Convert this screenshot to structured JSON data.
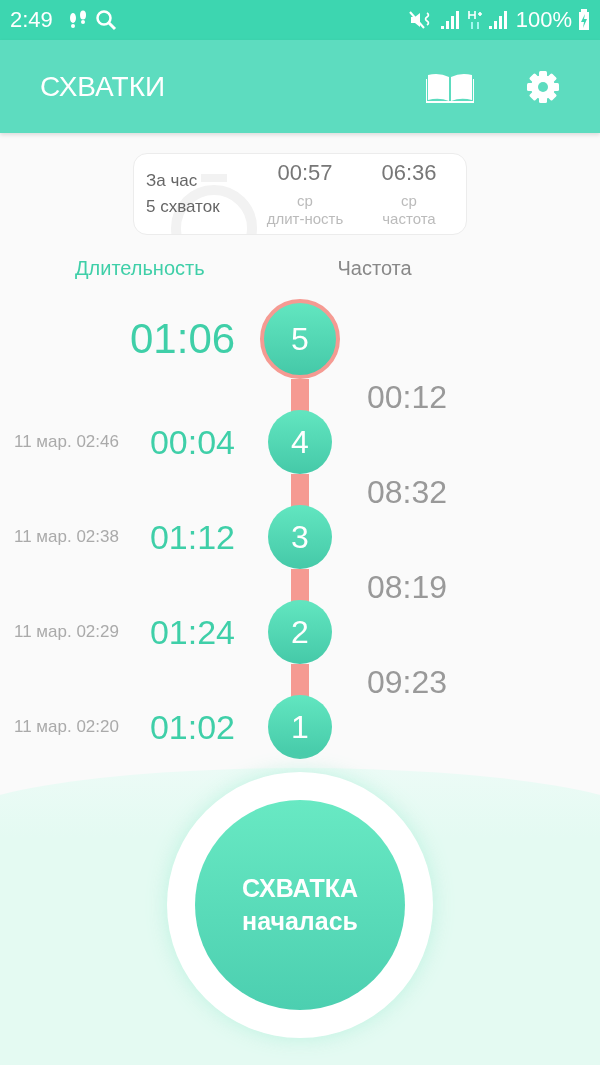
{
  "status_bar": {
    "time": "2:49",
    "battery": "100%"
  },
  "app_bar": {
    "title": "СХВАТКИ"
  },
  "summary": {
    "period": "За час",
    "count": "5 схваток",
    "stats": [
      {
        "value": "00:57",
        "prefix": "ср",
        "label": "длит-ность"
      },
      {
        "value": "06:36",
        "prefix": "ср",
        "label": "частота"
      }
    ]
  },
  "columns": [
    {
      "label": "Длительность",
      "selected": true
    },
    {
      "label": "Частота",
      "selected": false
    }
  ],
  "contractions": [
    {
      "number": "5",
      "duration": "01:06",
      "current": true,
      "interval_after": "00:12"
    },
    {
      "number": "4",
      "date": "11 мар. 02:46",
      "duration": "00:04",
      "current": false,
      "interval_after": "08:32"
    },
    {
      "number": "3",
      "date": "11 мар. 02:38",
      "duration": "01:12",
      "current": false,
      "interval_after": "08:19"
    },
    {
      "number": "2",
      "date": "11 мар. 02:29",
      "duration": "01:24",
      "current": false,
      "interval_after": "09:23"
    },
    {
      "number": "1",
      "date": "11 мар. 02:20",
      "duration": "01:02",
      "current": false
    }
  ],
  "start_button": {
    "line1": "СХВАТКА",
    "line2": "началась"
  }
}
